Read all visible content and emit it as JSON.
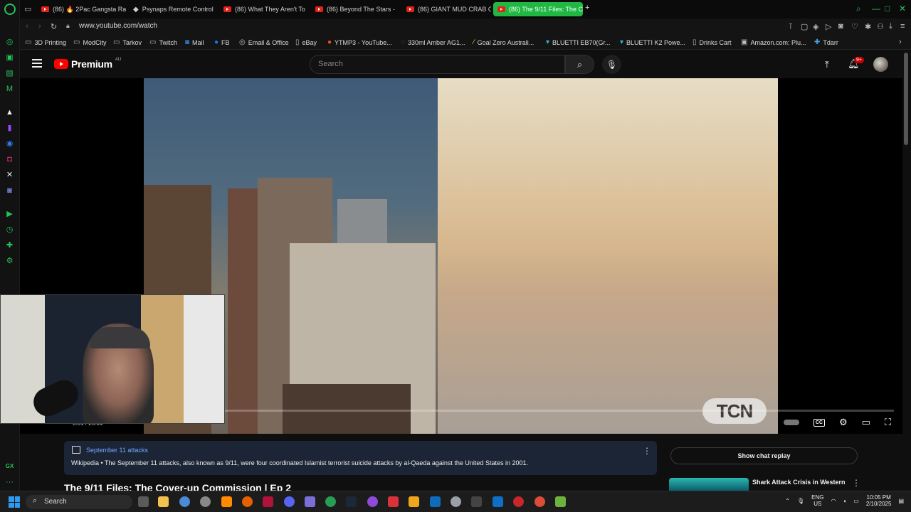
{
  "browser": {
    "tabs": [
      {
        "label": "(86) 🔥 2Pac Gangsta Rap",
        "active": false,
        "icon": "youtube-icon"
      },
      {
        "label": "Psynaps Remote Control",
        "active": false,
        "icon": "remote-icon"
      },
      {
        "label": "(86) What They Aren't To",
        "active": false,
        "icon": "youtube-icon"
      },
      {
        "label": "(86) Beyond The Stars - ",
        "active": false,
        "icon": "youtube-icon"
      },
      {
        "label": "(86) GIANT MUD CRAB C",
        "active": false,
        "icon": "youtube-icon"
      },
      {
        "label": "(86) The 9/11 Files: The C",
        "active": true,
        "icon": "youtube-icon"
      }
    ],
    "new_tab": "+",
    "url": "www.youtube.com/watch",
    "bookmarks": [
      {
        "label": "3D Printing",
        "icon": "folder-icon"
      },
      {
        "label": "ModCity",
        "icon": "folder-icon"
      },
      {
        "label": "Tarkov",
        "icon": "folder-icon"
      },
      {
        "label": "Twitch",
        "icon": "folder-icon"
      },
      {
        "label": "Mail",
        "icon": "outlook-icon"
      },
      {
        "label": "FB",
        "icon": "facebook-icon"
      },
      {
        "label": "Email & Office",
        "icon": "office-icon"
      },
      {
        "label": "eBay",
        "icon": "page-icon"
      },
      {
        "label": "YTMP3 - YouTube...",
        "icon": "ytmp3-icon"
      },
      {
        "label": "330ml Amber AG1...",
        "icon": "bottle-icon"
      },
      {
        "label": "Goal Zero Australi...",
        "icon": "pen-icon"
      },
      {
        "label": "BLUETTI EB70(Gr...",
        "icon": "bluetti-icon"
      },
      {
        "label": "BLUETTI K2 Powe...",
        "icon": "bluetti-icon"
      },
      {
        "label": "Drinks Cart",
        "icon": "page-icon"
      },
      {
        "label": "Amazon.com: Plu...",
        "icon": "amazon-icon"
      },
      {
        "label": "Tdarr",
        "icon": "tdarr-icon"
      }
    ]
  },
  "youtube": {
    "logo_text": "Premium",
    "region": "AU",
    "search_placeholder": "Search",
    "notification_count": "9+"
  },
  "player": {
    "watermark": "TCN",
    "time": "0:01 / 23:04",
    "progress": 0.001
  },
  "info_card": {
    "title": "September 11 attacks",
    "source": "Wikipedia",
    "text": "Wikipedia • The September 11 attacks, also known as 9/11, were four coordinated Islamist terrorist suicide attacks by al-Qaeda against the United States in 2001."
  },
  "video_title": "The 9/11 Files: The Cover-up Commission | Ep 2",
  "chat": {
    "label": "Show chat replay"
  },
  "recommendation": {
    "title": "Shark Attack Crisis in Western"
  },
  "taskbar": {
    "search": "Search",
    "lang_top": "ENG",
    "lang_bottom": "US",
    "time": "10:05 PM",
    "date": "2/10/2025"
  },
  "colors": {
    "opera_green": "#1fb843",
    "youtube_red": "#ff0000",
    "link_blue": "#6fa8ff"
  }
}
